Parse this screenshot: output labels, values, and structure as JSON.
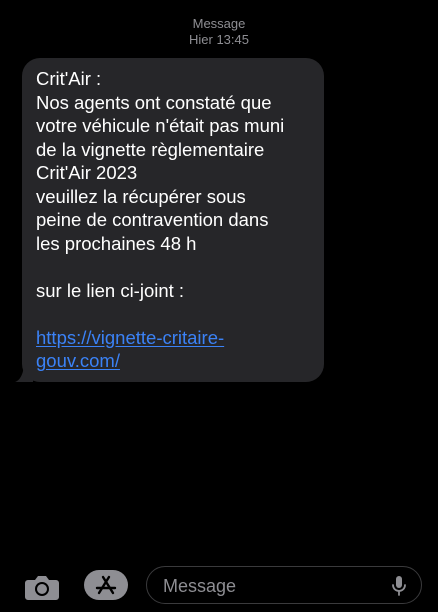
{
  "header": {
    "sender": "Message",
    "timestamp": "Hier 13:45"
  },
  "message": {
    "lines": [
      "Crit'Air :",
      "Nos agents ont constaté que",
      "votre véhicule n'était pas muni",
      "de la vignette règlementaire",
      "Crit'Air 2023",
      "veuillez la récupérer sous",
      "peine de contravention dans",
      "les prochaines 48 h"
    ],
    "link_intro": "sur le lien ci-joint :",
    "link_line1": "https://vignette-critaire-",
    "link_line2": "gouv.com/"
  },
  "composer": {
    "placeholder": "Message",
    "camera_icon": "camera-icon",
    "apps_icon": "app-store-icon",
    "mic_icon": "microphone-icon"
  },
  "colors": {
    "background": "#000000",
    "bubble": "#262629",
    "link": "#3b82f6",
    "muted": "#8e8e93"
  }
}
